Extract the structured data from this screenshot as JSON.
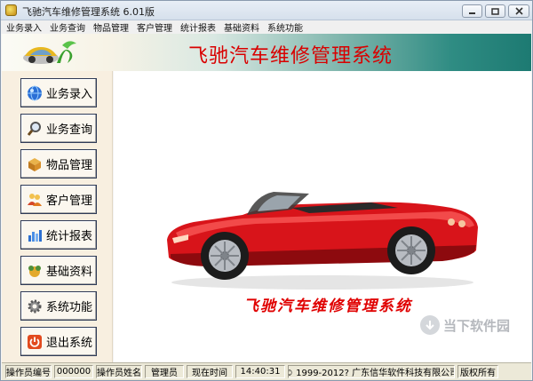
{
  "window": {
    "title": "飞驰汽车维修管理系统 6.01版"
  },
  "menu": [
    "业务录入",
    "业务查询",
    "物品管理",
    "客户管理",
    "统计报表",
    "基础资料",
    "系统功能"
  ],
  "banner": {
    "title": "飞驰汽车维修管理系统"
  },
  "sidebar": {
    "items": [
      {
        "label": "业务录入",
        "icon": "globe-icon"
      },
      {
        "label": "业务查询",
        "icon": "magnifier-icon"
      },
      {
        "label": "物品管理",
        "icon": "box-icon"
      },
      {
        "label": "客户管理",
        "icon": "people-icon"
      },
      {
        "label": "统计报表",
        "icon": "bar-chart-icon"
      },
      {
        "label": "基础资料",
        "icon": "data-icon"
      },
      {
        "label": "系统功能",
        "icon": "gear-icon"
      },
      {
        "label": "退出系统",
        "icon": "power-icon"
      }
    ]
  },
  "main": {
    "slogan": "飞驰汽车维修管理系统",
    "watermark": "当下软件园"
  },
  "statusbar": {
    "operator_id_label": "操作员编号",
    "operator_id": "000000",
    "operator_name_label": "操作员姓名",
    "operator_name": "管理员",
    "time_label": "现在时间",
    "time": "14:40:31",
    "copyright": "© 1999-2012?  广东信华软件科技有限公司",
    "rights": "版权所有"
  },
  "colors": {
    "banner_title": "#d90000",
    "slogan": "#e00000",
    "car_body": "#d8141a",
    "sidebar_bg": "#f8efe0"
  }
}
